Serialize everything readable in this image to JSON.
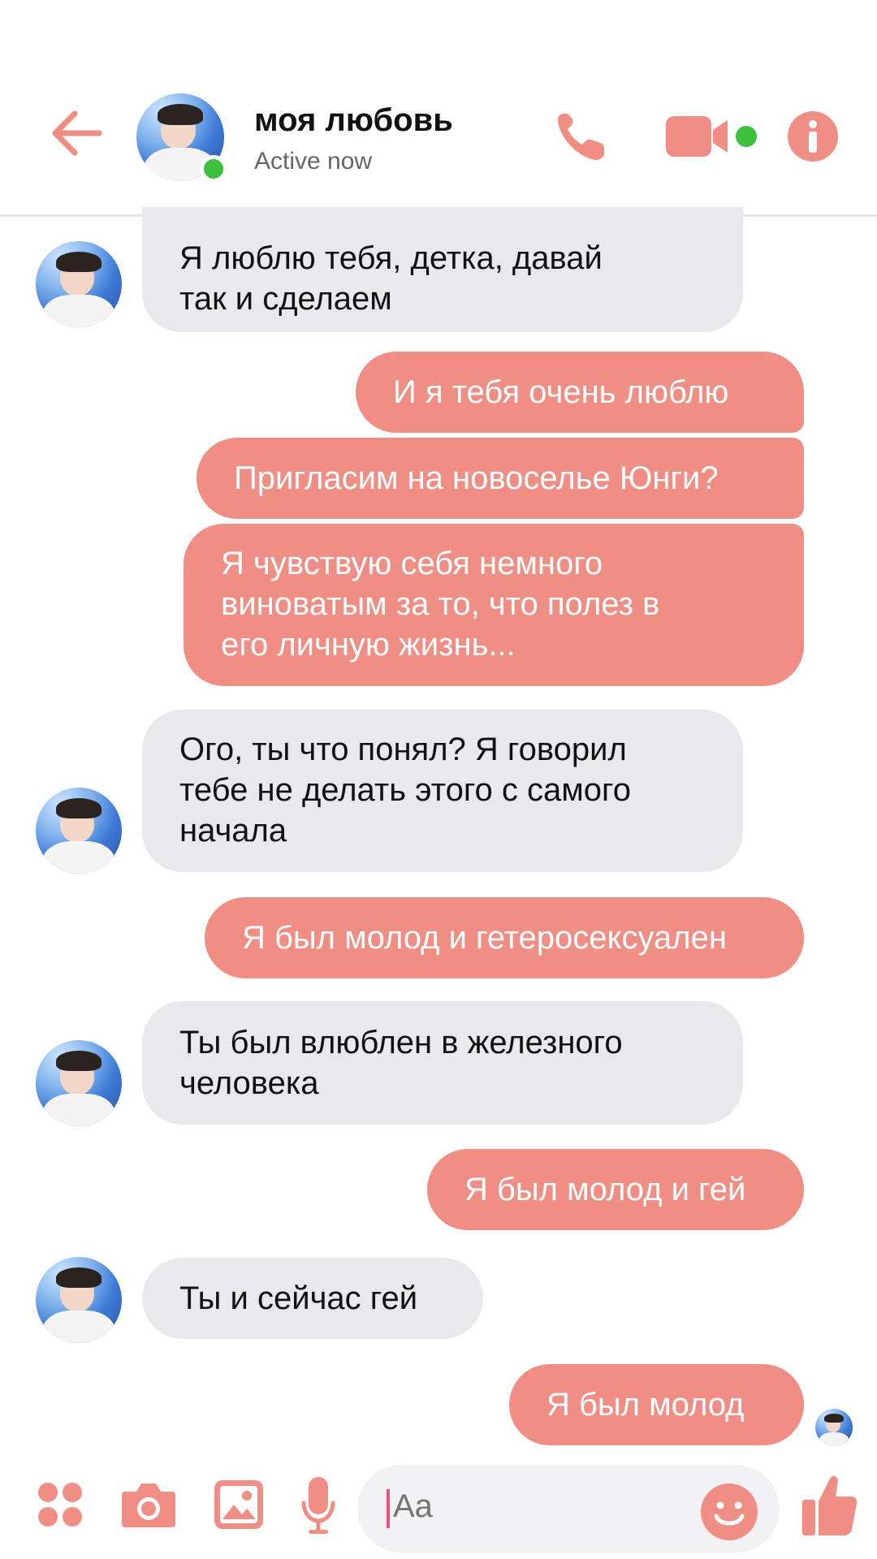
{
  "colors": {
    "accent": "#ef8e85",
    "incoming_bg": "#e9e9ed",
    "online": "#3fbf3f"
  },
  "header": {
    "contact_name": "моя любовь",
    "status": "Active now",
    "icons": [
      "back-arrow-icon",
      "phone-icon",
      "video-camera-icon",
      "info-icon"
    ]
  },
  "messages": [
    {
      "dir": "in",
      "text": "Я люблю тебя, детка, давай\nтак и сделаем"
    },
    {
      "dir": "out",
      "text": "И я тебя очень люблю"
    },
    {
      "dir": "out",
      "text": "Пригласим на новоселье Юнги?"
    },
    {
      "dir": "out",
      "text": "Я чувствую себя немного\nвиноватым за то, что полез в\nего личную жизнь..."
    },
    {
      "dir": "in",
      "text": "Ого, ты что понял? Я говорил\nтебе не делать этого с самого\nначала"
    },
    {
      "dir": "out",
      "text": "Я был молод и гетеросексуален"
    },
    {
      "dir": "in",
      "text": "Ты был влюблен в железного\nчеловека"
    },
    {
      "dir": "out",
      "text": "Я был молод и гей"
    },
    {
      "dir": "in",
      "text": "Ты и сейчас гей"
    },
    {
      "dir": "out",
      "text": "Я был молод"
    }
  ],
  "composer": {
    "placeholder": "Aa",
    "icons": [
      "apps-menu-icon",
      "camera-icon",
      "gallery-icon",
      "microphone-icon",
      "emoji-icon",
      "thumbs-up-icon"
    ]
  }
}
